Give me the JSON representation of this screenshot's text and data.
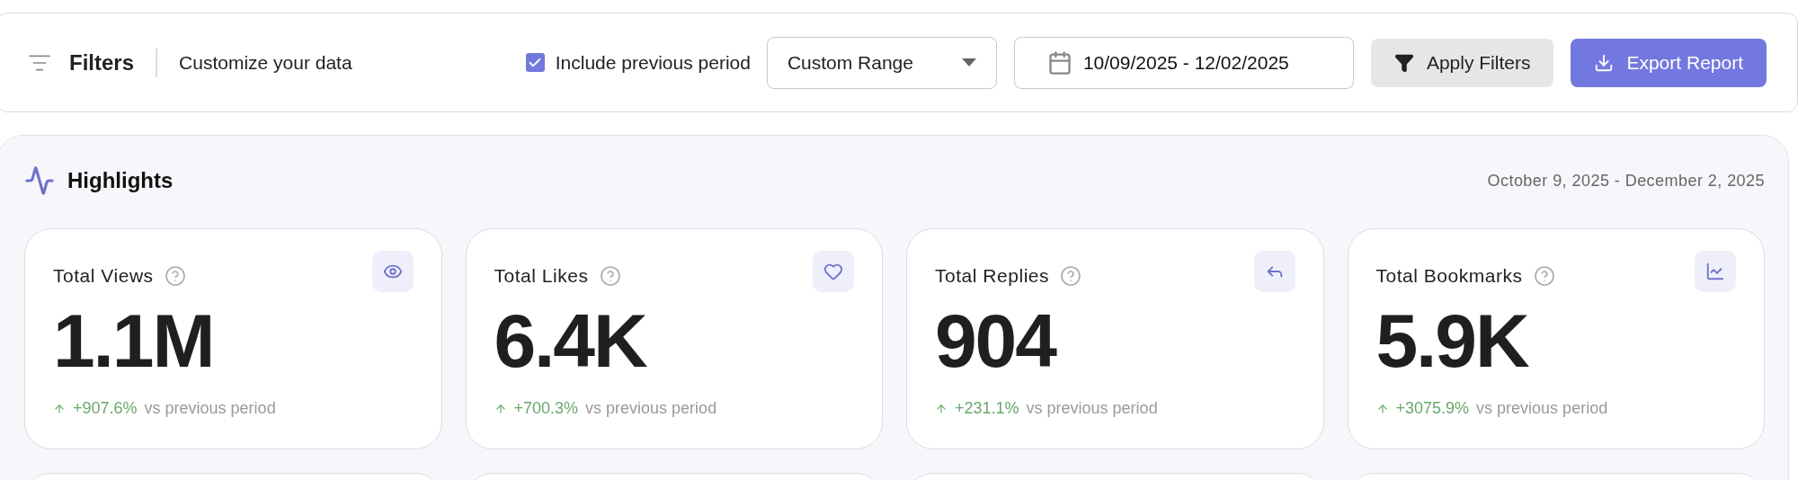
{
  "filter_bar": {
    "title": "Filters",
    "subtitle": "Customize your data",
    "include_previous": {
      "label": "Include previous period",
      "checked": true
    },
    "range_select": {
      "value": "Custom Range"
    },
    "date_field": {
      "value": "10/09/2025 - 12/02/2025"
    },
    "buttons": [
      {
        "label": "Apply Filters",
        "kind": "secondary"
      },
      {
        "label": "Export Report",
        "kind": "primary"
      }
    ]
  },
  "highlights": {
    "title": "Highlights",
    "date_range": "October 9, 2025 - December 2, 2025",
    "cards": [
      {
        "title": "Total Views",
        "value": "1.1M",
        "change": "+907.6%",
        "note": "vs previous period"
      },
      {
        "title": "Total Likes",
        "value": "6.4K",
        "change": "+700.3%",
        "note": "vs previous period"
      },
      {
        "title": "Total Replies",
        "value": "904",
        "change": "+231.1%",
        "note": "vs previous period"
      },
      {
        "title": "Total Bookmarks",
        "value": "5.9K",
        "change": "+3075.9%",
        "note": "vs previous period"
      }
    ]
  }
}
